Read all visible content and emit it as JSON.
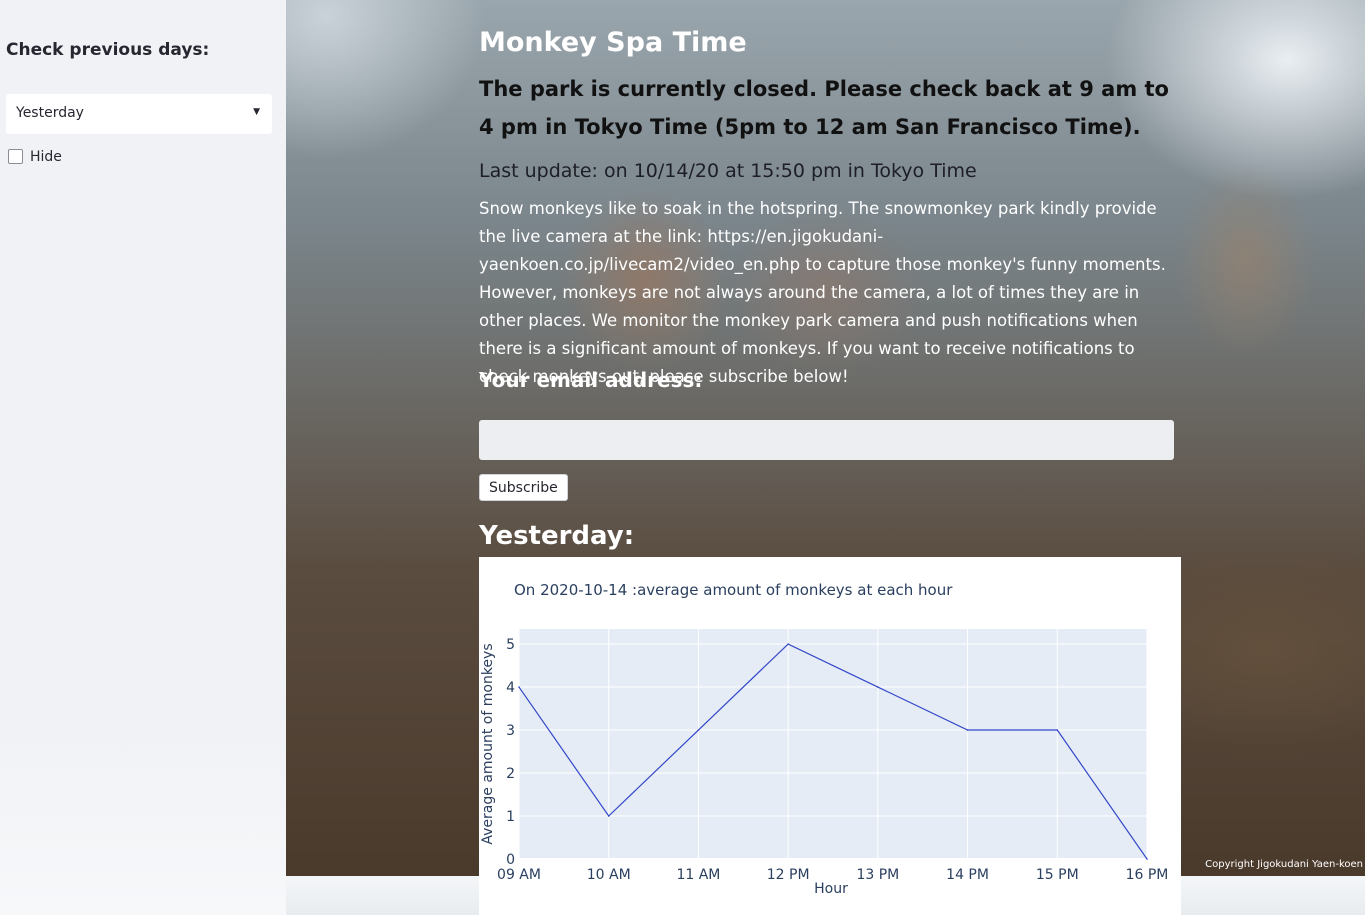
{
  "sidebar": {
    "title": "Check previous days:",
    "select_value": "Yesterday",
    "hide_label": "Hide",
    "hide_checked": false
  },
  "main": {
    "title": "Monkey Spa Time",
    "closed_notice": "The park is currently closed. Please check back at 9 am to 4 pm in Tokyo Time (5pm to 12 am San Francisco Time).",
    "last_update": "Last update: on 10/14/20 at 15:50 pm in Tokyo Time",
    "description": "Snow monkeys like to soak in the hotspring. The snowmonkey park kindly provide the live camera at the link: https://en.jigokudani-yaenkoen.co.jp/livecam2/video_en.php to capture those monkey's funny moments. However, monkeys are not always around the camera, a lot of times they are in other places. We monitor the monkey park camera and push notifications when there is a significant amount of monkeys. If you want to receive notifications to check monkeys out, please subscribe below!",
    "email_label": "Your email address:",
    "email_value": "",
    "subscribe_label": "Subscribe",
    "section_heading": "Yesterday:",
    "copyright": "Copyright Jigokudani Yaen-koen"
  },
  "colors": {
    "sidebar_bg": "#f0f2f6",
    "line": "#3347c9",
    "plot_bg": "#e5ecf6"
  },
  "chart_data": {
    "type": "line",
    "title": "On 2020-10-14 :average amount of monkeys at each hour",
    "xlabel": "Hour",
    "ylabel": "Average amount of monkeys",
    "categories": [
      "09 AM",
      "10 AM",
      "11 AM",
      "12 PM",
      "13 PM",
      "14 PM",
      "15 PM",
      "16 PM"
    ],
    "values": [
      4,
      1,
      3,
      5,
      4,
      3,
      3,
      0
    ],
    "y_ticks": [
      0,
      1,
      2,
      3,
      4,
      5
    ],
    "ylim": [
      0,
      5.35
    ],
    "grid": true,
    "legend": "none"
  }
}
